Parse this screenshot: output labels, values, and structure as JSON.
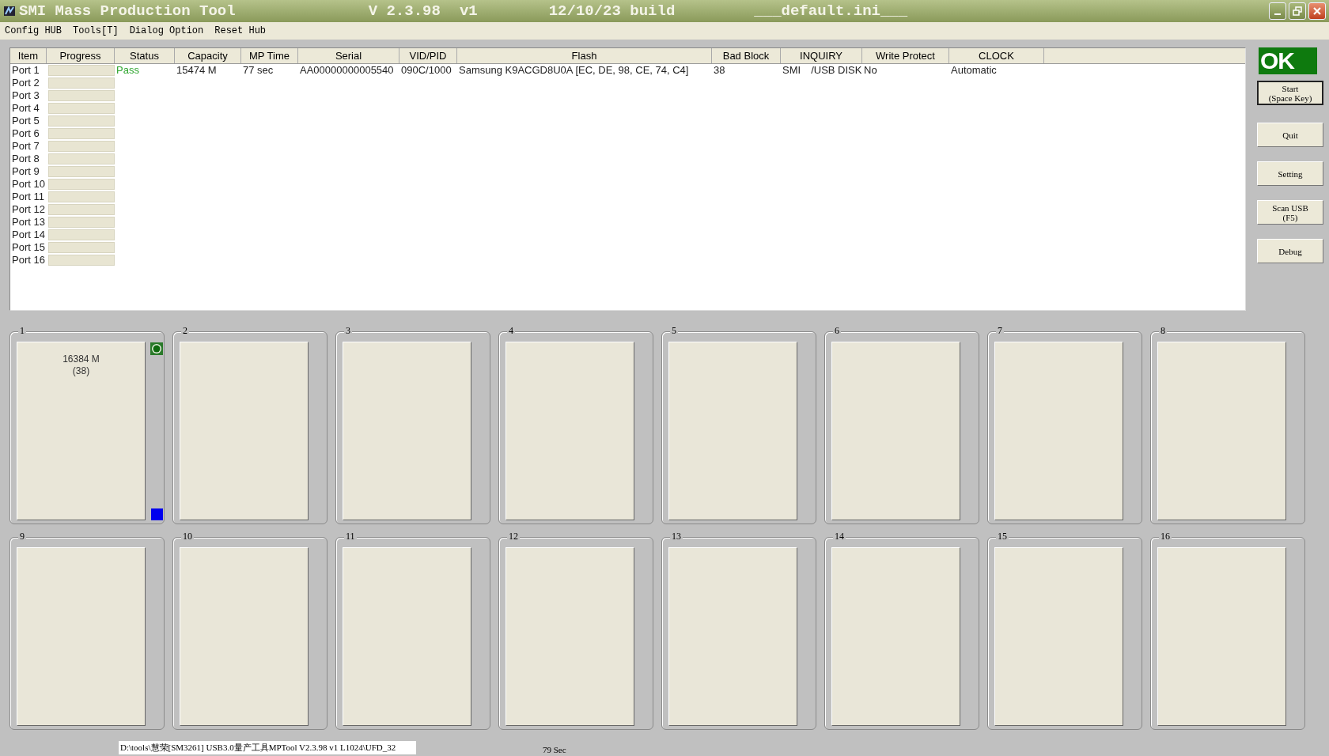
{
  "window": {
    "title": "SMI Mass Production Tool",
    "version": "V 2.3.98",
    "variant": "v1",
    "build": "12/10/23 build",
    "ini": "___default.ini___"
  },
  "menu": [
    "Config HUB",
    "Tools[T]",
    "Dialog Option",
    "Reset Hub"
  ],
  "table": {
    "columns": [
      "Item",
      "Progress",
      "Status",
      "Capacity",
      "MP Time",
      "Serial",
      "VID/PID",
      "Flash",
      "Bad Block",
      "INQUIRY",
      "Write Protect",
      "CLOCK"
    ],
    "rows": [
      {
        "item": "Port 1",
        "level": 0,
        "status": "Pass",
        "capacity": "15474 M",
        "mp_time": "77 sec",
        "serial": "AA00000000005540",
        "vid_pid": "090C/1000",
        "flash": "Samsung K9ACGD8U0A [EC, DE, 98, CE, 74, C4]",
        "bad_block": "38",
        "inquiry_vendor": "SMI",
        "inquiry_product": "/USB DISK",
        "write_protect": "No",
        "clock": "Automatic"
      },
      {
        "item": "Port 2",
        "level": 0
      },
      {
        "item": "Port 3",
        "level": 0
      },
      {
        "item": "Port 4",
        "level": 0
      },
      {
        "item": "Port 5",
        "level": 0
      },
      {
        "item": "Port 6",
        "level": 0
      },
      {
        "item": "Port 7",
        "level": 0
      },
      {
        "item": "Port 8",
        "level": 0
      },
      {
        "item": "Port 9",
        "level": 0
      },
      {
        "item": "Port 10",
        "level": 0
      },
      {
        "item": "Port 11",
        "level": 0
      },
      {
        "item": "Port 12",
        "level": 0
      },
      {
        "item": "Port 13",
        "level": 0
      },
      {
        "item": "Port 14",
        "level": 0
      },
      {
        "item": "Port 15",
        "level": 0
      },
      {
        "item": "Port 16",
        "level": 0
      }
    ]
  },
  "result": "OK",
  "buttons": [
    {
      "lines": [
        "Start",
        "(Space Key)"
      ],
      "default": true
    },
    {
      "lines": [
        "Quit"
      ],
      "default": false
    },
    {
      "lines": [
        "Setting"
      ],
      "default": false
    },
    {
      "lines": [
        "Scan USB",
        "(F5)"
      ],
      "default": false
    },
    {
      "lines": [
        "Debug"
      ],
      "default": false
    }
  ],
  "ports": [
    {
      "label": "1",
      "connected": true,
      "capacity": "16384 M",
      "bad_blocks": "(38)"
    },
    {
      "label": "2",
      "connected": false
    },
    {
      "label": "3",
      "connected": false
    },
    {
      "label": "4",
      "connected": false
    },
    {
      "label": "5",
      "connected": false
    },
    {
      "label": "6",
      "connected": false
    },
    {
      "label": "7",
      "connected": false
    },
    {
      "label": "8",
      "connected": false
    },
    {
      "label": "9",
      "connected": false
    },
    {
      "label": "10",
      "connected": false
    },
    {
      "label": "11",
      "connected": false
    },
    {
      "label": "12",
      "connected": false
    },
    {
      "label": "13",
      "connected": false
    },
    {
      "label": "14",
      "connected": false
    },
    {
      "label": "15",
      "connected": false
    },
    {
      "label": "16",
      "connected": false
    }
  ],
  "status_bar": {
    "path": "D:\\tools\\慧荣[SM3261] USB3.0量产工具MPTool V2.3.98 v1 L1024\\UFD_32",
    "elapsed": "79 Sec"
  }
}
